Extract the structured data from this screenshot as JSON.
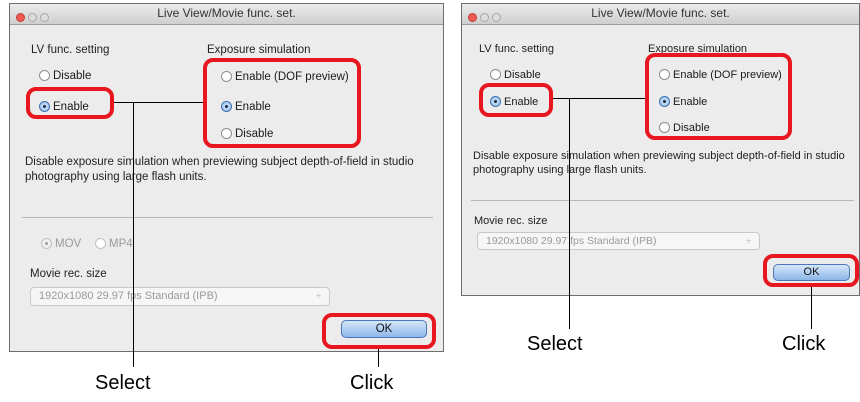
{
  "left_dialog": {
    "title": "Live View/Movie func. set.",
    "lv_label": "LV func. setting",
    "lv_options": [
      "Disable",
      "Enable"
    ],
    "exposure_label": "Exposure simulation",
    "exposure_options": [
      "Enable (DOF preview)",
      "Enable",
      "Disable"
    ],
    "description": "Disable exposure simulation when previewing subject depth-of-field in studio photography using large flash units.",
    "format_options": [
      "MOV",
      "MP4"
    ],
    "movie_label": "Movie rec. size",
    "movie_value": "1920x1080 29.97 fps  Standard (IPB)",
    "select_arrows": "÷",
    "ok_label": "OK"
  },
  "right_dialog": {
    "title": "Live View/Movie func. set.",
    "lv_label": "LV func. setting",
    "lv_options": [
      "Disable",
      "Enable"
    ],
    "exposure_label": "Exposure simulation",
    "exposure_options": [
      "Enable (DOF preview)",
      "Enable",
      "Disable"
    ],
    "description": "Disable exposure simulation when previewing subject depth-of-field in studio photography using large flash units.",
    "movie_label": "Movie rec. size",
    "movie_value": "1920x1080 29.97 fps  Standard (IPB)",
    "select_arrows": "÷",
    "ok_label": "OK"
  },
  "callouts": {
    "left_select": "Select",
    "left_click": "Click",
    "right_select": "Select",
    "right_click": "Click"
  },
  "colors": {
    "highlight": "#e8171f",
    "window_bg": "#ececec",
    "ok_button": "#8cb6e8"
  }
}
